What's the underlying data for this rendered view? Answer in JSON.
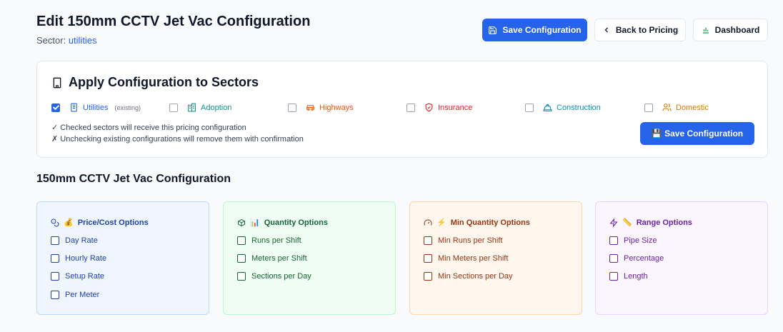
{
  "header": {
    "title": "Edit 150mm CCTV Jet Vac Configuration",
    "sector_label": "Sector:",
    "sector_value": "utilities",
    "save_label": "Save Configuration",
    "back_label": "Back to Pricing",
    "dashboard_label": "Dashboard"
  },
  "apply": {
    "title": "Apply Configuration to Sectors",
    "sectors": [
      {
        "label": "Utilities",
        "checked": true,
        "note": "(existing)",
        "color": "#2563eb",
        "icon": "building-icon"
      },
      {
        "label": "Adoption",
        "checked": false,
        "note": "",
        "color": "#0d9488",
        "icon": "buildings-icon"
      },
      {
        "label": "Highways",
        "checked": false,
        "note": "",
        "color": "#ea580c",
        "icon": "car-icon"
      },
      {
        "label": "Insurance",
        "checked": false,
        "note": "",
        "color": "#dc2626",
        "icon": "shield-icon"
      },
      {
        "label": "Construction",
        "checked": false,
        "note": "",
        "color": "#0891b2",
        "icon": "hardhat-icon"
      },
      {
        "label": "Domestic",
        "checked": false,
        "note": "",
        "color": "#d97706",
        "icon": "users-icon"
      }
    ],
    "note_checked": "✓ Checked sectors will receive this pricing configuration",
    "note_unchecked": "✗ Unchecking existing configurations will remove them with confirmation",
    "save_label": "💾 Save Configuration"
  },
  "config": {
    "heading": "150mm CCTV Jet Vac Configuration",
    "panels": [
      {
        "title": "Price/Cost Options",
        "emoji": "💰",
        "icon": "coins-icon",
        "options": [
          "Day Rate",
          "Hourly Rate",
          "Setup Rate",
          "Per Meter"
        ]
      },
      {
        "title": "Quantity Options",
        "emoji": "📊",
        "icon": "package-icon",
        "options": [
          "Runs per Shift",
          "Meters per Shift",
          "Sections per Day"
        ]
      },
      {
        "title": "Min Quantity Options",
        "emoji": "⚡",
        "icon": "gauge-icon",
        "options": [
          "Min Runs per Shift",
          "Min Meters per Shift",
          "Min Sections per Day"
        ]
      },
      {
        "title": "Range Options",
        "emoji": "📏",
        "icon": "zap-icon",
        "options": [
          "Pipe Size",
          "Percentage",
          "Length"
        ]
      }
    ]
  }
}
